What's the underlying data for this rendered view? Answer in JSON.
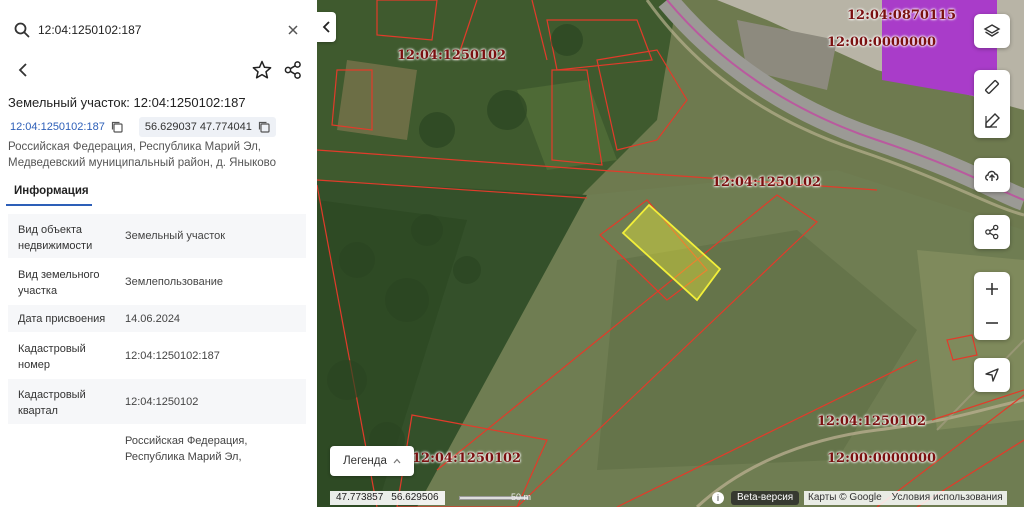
{
  "search": {
    "value": "12:04:1250102:187"
  },
  "object": {
    "title": "Земельный участок: 12:04:1250102:187",
    "cadastral_link": "12:04:1250102:187",
    "coordinates": "56.629037 47.774041",
    "address": "Российская Федерация, Республика Марий Эл, Медведевский муниципальный район, д. Яныково"
  },
  "tabs": [
    {
      "label": "Информация"
    }
  ],
  "info_rows": [
    {
      "key": "Вид объекта недвижимости",
      "value": "Земельный участок"
    },
    {
      "key": "Вид земельного участка",
      "value": "Землепользование"
    },
    {
      "key": "Дата присвоения",
      "value": "14.06.2024"
    },
    {
      "key": "Кадастровый номер",
      "value": "12:04:1250102:187"
    },
    {
      "key": "Кадастровый квартал",
      "value": "12:04:1250102"
    },
    {
      "key": "",
      "value": "Российская Федерация, Республика Марий Эл,"
    }
  ],
  "map": {
    "labels": [
      "12:04:0870115",
      "12:00:0000000",
      "12:04:1250102",
      "12:04:1250102",
      "12:04:1250102",
      "12:00:0000000",
      "12:04:1250102"
    ],
    "legend_label": "Легенда",
    "cursor_coords": {
      "lon": "47.773857",
      "lat": "56.629506"
    },
    "scale_label": "50 m",
    "beta_label": "Beta-версия",
    "attribution": "Карты © Google",
    "terms": "Условия использования",
    "colors": {
      "parcel_outline": "#e23b2a",
      "selected_parcel": "#f2ef3a",
      "industrial_zone": "#a93cc9"
    }
  }
}
